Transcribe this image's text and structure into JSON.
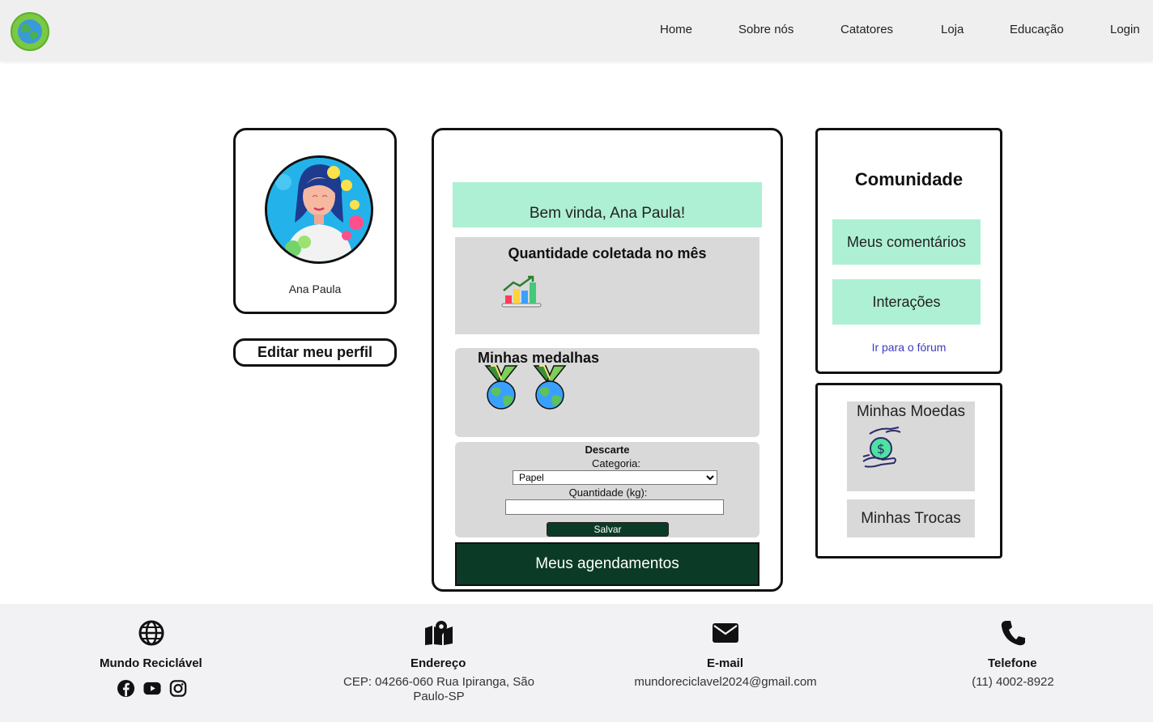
{
  "nav": {
    "logo_icon": "recycling-globe-logo",
    "links": [
      "Home",
      "Sobre nós",
      "Catatores",
      "Loja",
      "Educação",
      "Login"
    ]
  },
  "profile": {
    "name": "Ana Paula",
    "edit_label": "Editar meu perfil"
  },
  "main": {
    "welcome": "Bem vinda, Ana Paula!",
    "qty_title": "Quantidade coletada no mês",
    "medals_title": "Minhas medalhas",
    "medal_count": 2,
    "discard": {
      "title": "Descarte",
      "category_label": "Categoria:",
      "category_value": "Papel",
      "quantity_label": "Quantidade (kg):",
      "quantity_value": "",
      "save_label": "Salvar"
    },
    "schedule_label": "Meus agendamentos"
  },
  "community": {
    "title": "Comunidade",
    "comments_label": "Meus comentários",
    "interactions_label": "Interações",
    "forum_link": "Ir para o fórum"
  },
  "coins": {
    "title": "Minhas Moedas",
    "trades_label": "Minhas Trocas"
  },
  "footer": {
    "brand": "Mundo Reciclável",
    "address_title": "Endereço",
    "address_line1": "CEP: 04266-060 Rua Ipiranga, São",
    "address_line2": "Paulo-SP",
    "email_title": "E-mail",
    "email": "mundoreciclavel2024@gmail.com",
    "phone_title": "Telefone",
    "phone": "(11) 4002-8922"
  },
  "colors": {
    "accent_green": "#aef0d4",
    "dark_green": "#0b3b26",
    "panel_gray": "#d9d9d9",
    "link_blue": "#3b3bbd"
  }
}
